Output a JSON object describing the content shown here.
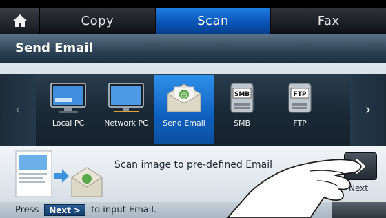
{
  "tabs": [
    {
      "label": "Copy"
    },
    {
      "label": "Scan",
      "active": true
    },
    {
      "label": "Fax"
    }
  ],
  "header": {
    "title": "Send Email"
  },
  "scan_options": [
    {
      "label": "Local PC",
      "icon": "monitor-icon"
    },
    {
      "label": "Network PC",
      "icon": "network-monitor-icon"
    },
    {
      "label": "Send Email",
      "icon": "email-envelope-icon",
      "selected": true
    },
    {
      "label": "SMB",
      "icon": "smb-drive-icon"
    },
    {
      "label": "FTP",
      "icon": "ftp-drive-icon"
    }
  ],
  "description": {
    "text": "Scan image to pre-defined Email"
  },
  "next_button": {
    "label": "Next"
  },
  "status_bar": {
    "prefix": "Press",
    "key_label": "Next >",
    "suffix": "to input Email."
  },
  "colors": {
    "active_tab": "#1270d6",
    "selected_item": "#1f79d8",
    "header": "#3b5468"
  }
}
